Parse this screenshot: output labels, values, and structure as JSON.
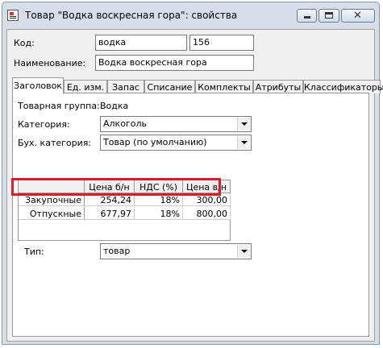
{
  "window": {
    "title": "Товар \"Водка воскресная гора\": свойства"
  },
  "header": {
    "code_label": "Код:",
    "code_value": "водка",
    "number_value": "156",
    "name_label": "Наименование:",
    "name_value": "Водка воскресная гора"
  },
  "tabs": [
    {
      "label": "Заголовок"
    },
    {
      "label": "Ед. изм."
    },
    {
      "label": "Запас"
    },
    {
      "label": "Списание"
    },
    {
      "label": "Комплекты"
    },
    {
      "label": "Атрибуты"
    },
    {
      "label": "Классификаторы"
    }
  ],
  "panel": {
    "group_label": "Товарная группа:",
    "group_value": "Водка",
    "category_label": "Категория:",
    "category_value": "Алкоголь",
    "acc_category_label": "Бух. категория:",
    "acc_category_value": "Товар (по умолчанию)",
    "type_label": "Тип:",
    "type_value": "товар"
  },
  "price_table": {
    "columns": [
      "Цена б/н",
      "НДС (%)",
      "Цена в/н"
    ],
    "rows": [
      {
        "name": "Закупочные",
        "price_net": "254,24",
        "vat": "18%",
        "price_gross": "300,00"
      },
      {
        "name": "Отпускные",
        "price_net": "677,97",
        "vat": "18%",
        "price_gross": "800,00"
      }
    ]
  },
  "colors": {
    "highlight": "#d21f2a",
    "window_frame": "#d6dfe9"
  }
}
